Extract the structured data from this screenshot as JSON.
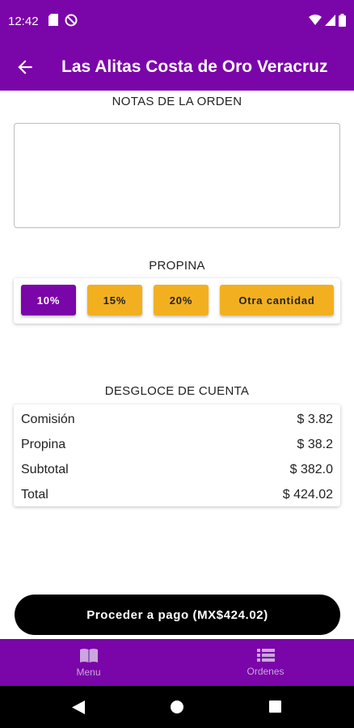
{
  "status_bar": {
    "time": "12:42"
  },
  "appbar": {
    "title": "Las Alitas Costa de Oro Veracruz"
  },
  "notes": {
    "label": "NOTAS DE LA ORDEN",
    "value": ""
  },
  "tip": {
    "label": "PROPINA",
    "options": [
      "10%",
      "15%",
      "20%",
      "Otra cantidad"
    ],
    "selected": "10%"
  },
  "breakdown": {
    "label": "DESGLOCE DE CUENTA",
    "rows": [
      {
        "label": "Comisión",
        "value": "$ 3.82"
      },
      {
        "label": "Propina",
        "value": "$ 38.2"
      },
      {
        "label": "Subtotal",
        "value": "$ 382.0"
      },
      {
        "label": "Total",
        "value": "$ 424.02"
      }
    ]
  },
  "pay_button": {
    "label": "Proceder a pago (MX$424.02)"
  },
  "bottom_nav": {
    "items": [
      {
        "label": "Menu",
        "icon": "book-icon"
      },
      {
        "label": "Ordenes",
        "icon": "list-icon"
      }
    ]
  },
  "colors": {
    "primary": "#7a05a8",
    "accent": "#f2b020",
    "dark": "#000000"
  }
}
